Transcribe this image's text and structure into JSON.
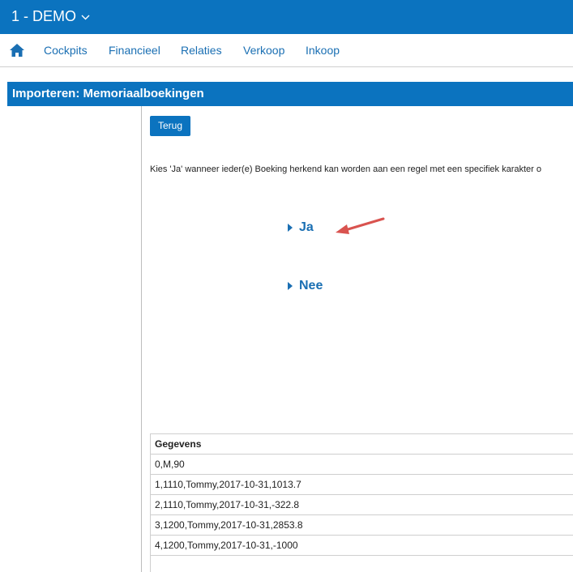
{
  "app": {
    "title": "1 - DEMO"
  },
  "nav": {
    "home_icon": "home-icon",
    "items": [
      "Cockpits",
      "Financieel",
      "Relaties",
      "Verkoop",
      "Inkoop"
    ]
  },
  "page": {
    "title": "Importeren: Memoriaalboekingen",
    "back_label": "Terug",
    "instruction": "Kies 'Ja' wanneer ieder(e) Boeking herkend kan worden aan een regel met een specifiek karakter o"
  },
  "choices": {
    "yes": "Ja",
    "no": "Nee"
  },
  "table": {
    "header": "Gegevens",
    "rows": [
      "0,M,90",
      "1,1110,Tommy,2017-10-31,1013.7",
      "2,1110,Tommy,2017-10-31,-322.8",
      "3,1200,Tommy,2017-10-31,2853.8",
      "4,1200,Tommy,2017-10-31,-1000"
    ]
  },
  "colors": {
    "brand": "#0b73bf",
    "link": "#1a6fb3",
    "annotation_arrow": "#d9534f"
  }
}
